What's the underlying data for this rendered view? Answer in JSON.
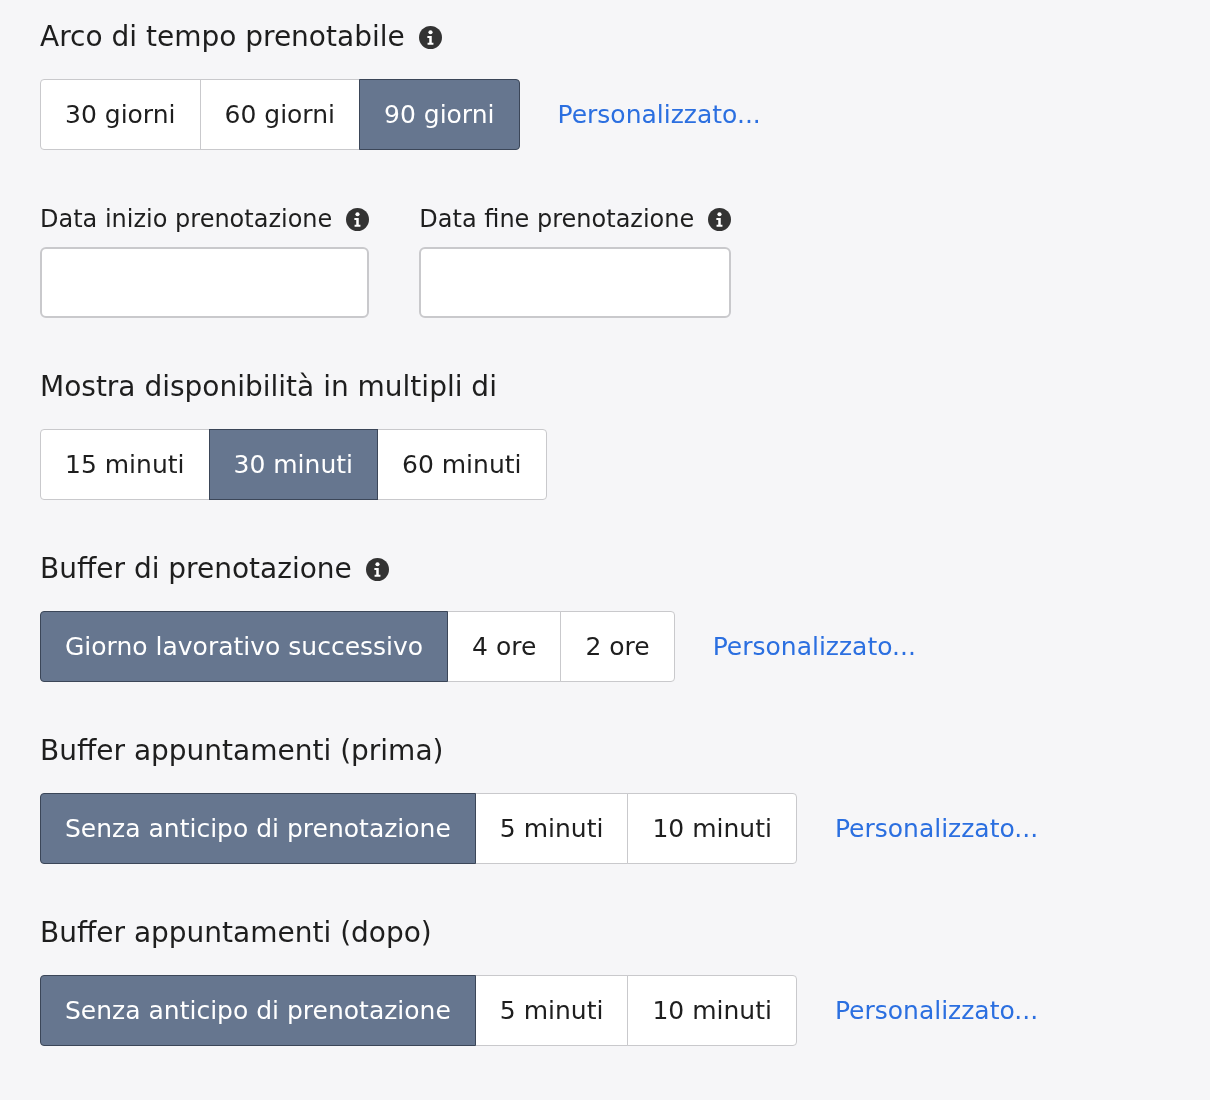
{
  "sections": [
    {
      "kind": "segmented",
      "title": "Arco di tempo prenotabile",
      "info": true,
      "options": [
        {
          "label": "30 giorni",
          "selected": false
        },
        {
          "label": "60 giorni",
          "selected": false
        },
        {
          "label": "90 giorni",
          "selected": true
        }
      ],
      "custom_link": "Personalizzato..."
    },
    {
      "kind": "dates",
      "fields": [
        {
          "label": "Data inizio prenotazione",
          "info": true
        },
        {
          "label": "Data fine prenotazione",
          "info": true
        }
      ]
    },
    {
      "kind": "segmented",
      "title": "Mostra disponibilità in multipli di",
      "info": false,
      "options": [
        {
          "label": "15 minuti",
          "selected": false
        },
        {
          "label": "30 minuti",
          "selected": true
        },
        {
          "label": "60 minuti",
          "selected": false
        }
      ]
    },
    {
      "kind": "segmented",
      "title": "Buffer di prenotazione",
      "info": true,
      "options": [
        {
          "label": "Giorno lavorativo successivo",
          "selected": true
        },
        {
          "label": "4 ore",
          "selected": false
        },
        {
          "label": "2 ore",
          "selected": false
        }
      ],
      "custom_link": "Personalizzato..."
    },
    {
      "kind": "segmented",
      "title": "Buffer appuntamenti (prima)",
      "info": false,
      "options": [
        {
          "label": "Senza anticipo di prenotazione",
          "selected": true
        },
        {
          "label": "5 minuti",
          "selected": false
        },
        {
          "label": "10 minuti",
          "selected": false
        }
      ],
      "custom_link": "Personalizzato..."
    },
    {
      "kind": "segmented",
      "title": "Buffer appuntamenti (dopo)",
      "info": false,
      "options": [
        {
          "label": "Senza anticipo di prenotazione",
          "selected": true
        },
        {
          "label": "5 minuti",
          "selected": false
        },
        {
          "label": "10 minuti",
          "selected": false
        }
      ],
      "custom_link": "Personalizzato..."
    }
  ]
}
